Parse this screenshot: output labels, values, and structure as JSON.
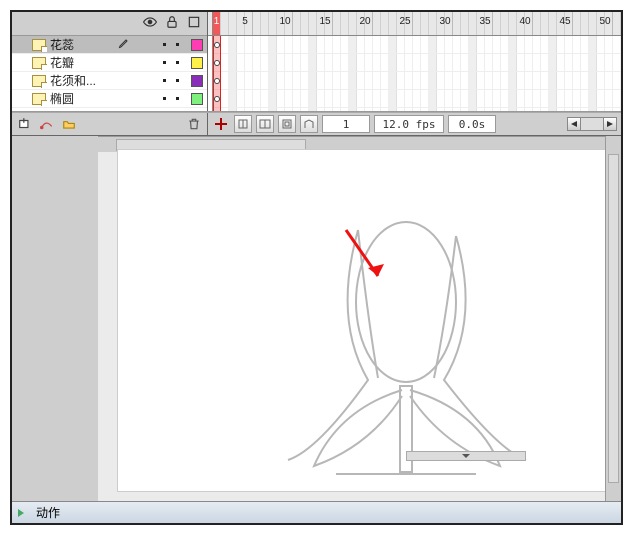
{
  "timeline": {
    "layers": [
      {
        "name": "花蕊",
        "color": "#ff3db2",
        "selected": true,
        "editing": true
      },
      {
        "name": "花瓣",
        "color": "#fff04a",
        "selected": false,
        "editing": false
      },
      {
        "name": "花须和...",
        "color": "#8a2db8",
        "selected": false,
        "editing": false
      },
      {
        "name": "椭圆",
        "color": "#7ef07e",
        "selected": false,
        "editing": false
      }
    ],
    "ruler": {
      "labels": [
        "1",
        "5",
        "10",
        "15",
        "20",
        "25",
        "30",
        "35",
        "40",
        "45",
        "50"
      ]
    }
  },
  "controls": {
    "current_frame": "1",
    "fps": "12.0 fps",
    "time": "0.0s"
  },
  "actions_panel": {
    "label": "动作"
  },
  "chart_data": null
}
